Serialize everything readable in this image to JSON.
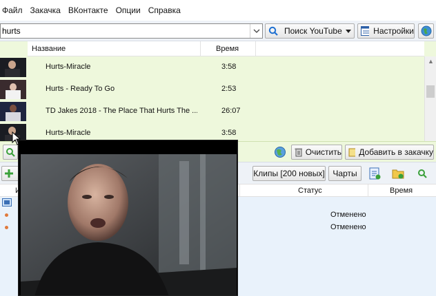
{
  "menu": [
    "Файл",
    "Закачка",
    "ВКонтакте",
    "Опции",
    "Справка"
  ],
  "search": {
    "value": "hurts",
    "youtube_label": "Поиск YouTube",
    "settings_label": "Настройки"
  },
  "results": {
    "col_title": "Название",
    "col_time": "Время",
    "rows": [
      {
        "title": "Hurts-Miracle",
        "time": "3:58"
      },
      {
        "title": "Hurts - Ready To Go",
        "time": "2:53"
      },
      {
        "title": "TD Jakes 2018 - The Place That Hurts The ...",
        "time": "26:07"
      },
      {
        "title": "Hurts-Miracle",
        "time": "3:58"
      }
    ]
  },
  "actions": {
    "clear_label": "Очистить",
    "add_label": "Добавить в закачку"
  },
  "downloads_toolbar": {
    "clips_label": "Клипы [200 новых]",
    "charts_label": "Чарты"
  },
  "downloads": {
    "col_name_partial": "И",
    "col_status": "Статус",
    "col_time": "Время",
    "rows": [
      {
        "status": "Отменено"
      },
      {
        "status": "Отменено"
      }
    ]
  },
  "icons": {
    "search": "search-icon",
    "globe": "globe-icon",
    "settings": "settings-icon",
    "clear": "trash-icon",
    "add": "add-download-icon"
  },
  "colors": {
    "results_bg": "#eef8dc",
    "downloads_bg": "#e9f2fb",
    "toolbar_bg": "#eef2f7",
    "status_dot": "#e07a3c"
  }
}
